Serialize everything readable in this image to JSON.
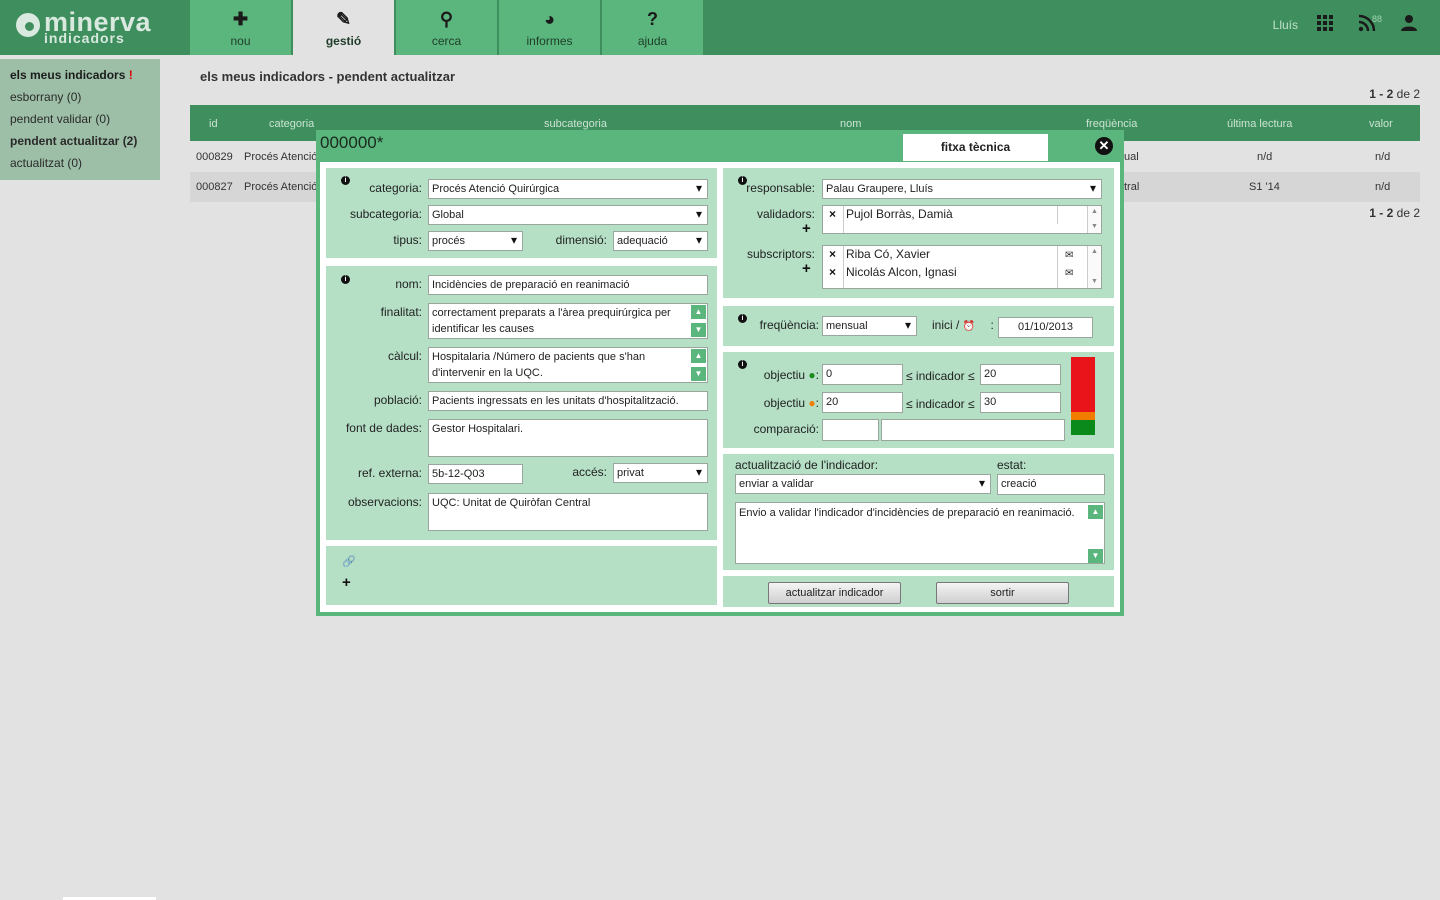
{
  "app": {
    "logo_main": "minerva",
    "logo_sub": "indicadors"
  },
  "nav": [
    {
      "label": "nou",
      "icon": "plus-grid-icon",
      "glyph": "✚"
    },
    {
      "label": "gestió",
      "icon": "edit-icon",
      "glyph": "✎"
    },
    {
      "label": "cerca",
      "icon": "search-icon",
      "glyph": "⚲"
    },
    {
      "label": "informes",
      "icon": "pie-chart-icon",
      "glyph": "◕"
    },
    {
      "label": "ajuda",
      "icon": "question-icon",
      "glyph": "?"
    }
  ],
  "header": {
    "user": "Lluís",
    "rss_count": "88"
  },
  "sidemenu": {
    "title": "els meus indicadors",
    "title_mark": "!",
    "items": [
      "esborrany (0)",
      "pendent validar (0)",
      "pendent actualitzar (2)",
      "actualitzat (0)"
    ]
  },
  "main": {
    "title": "els meus indicadors - pendent actualitzar",
    "pager_range": "1 - 2",
    "pager_of": "de 2",
    "columns": [
      "id",
      "categoria",
      "subcategoria",
      "nom",
      "freqüència",
      "última lectura",
      "valor"
    ],
    "rows": [
      {
        "id": "000829",
        "categoria": "Procés Atenció",
        "freq": "ual",
        "ultima": "n/d",
        "valor": "n/d"
      },
      {
        "id": "000827",
        "categoria": "Procés Atenció",
        "freq": "tral",
        "ultima": "S1 '14",
        "valor": "n/d"
      }
    ]
  },
  "modal": {
    "code": "000000*",
    "tab": "fitxa tècnica",
    "close": "✕",
    "general": {
      "categoria_label": "categoria:",
      "categoria": "Procés Atenció Quirúrgica",
      "subcategoria_label": "subcategoria:",
      "subcategoria": "Global",
      "tipus_label": "tipus:",
      "tipus": "procés",
      "dimensio_label": "dimensió:",
      "dimensio": "adequació"
    },
    "details": {
      "nom_label": "nom:",
      "nom": "Incidències de preparació en reanimació",
      "finalitat_label": "finalitat:",
      "finalitat": "correctament preparats a l'àrea prequirúrgica per identificar les causes",
      "calcul_label": "càlcul:",
      "calcul": "Hospitalaria /Número de pacients que s'han d'intervenir en la UQC.",
      "poblacio_label": "població:",
      "poblacio": "Pacients ingressats en les unitats d'hospitalització.",
      "font_label": "font de dades:",
      "font": "Gestor Hospitalari.",
      "ref_label": "ref. externa:",
      "ref": "5b-12-Q03",
      "acces_label": "accés:",
      "acces": "privat",
      "obs_label": "observacions:",
      "obs": "UQC: Unitat de Quiròfan Central"
    },
    "people": {
      "responsable_label": "responsable:",
      "responsable": "Palau Graupere, Lluís",
      "validadors_label": "validadors:",
      "validadors": [
        "Pujol Borràs, Damià"
      ],
      "subscriptors_label": "subscriptors:",
      "subscriptors": [
        "Riba Có, Xavier",
        "Nicolás Alcon, Ignasi"
      ]
    },
    "frequency": {
      "label": "freqüència:",
      "value": "mensual",
      "inici_label": "inici /",
      "inici_colon": ":",
      "inici": "01/10/2013"
    },
    "objectives": {
      "obj_label": "objectiu",
      "leq_ind": "≤ indicador ≤",
      "green_min": "0",
      "green_max": "20",
      "orange_min": "20",
      "orange_max": "30",
      "comparacio_label": "comparació:",
      "colors": {
        "red": "#e8141a",
        "orange": "#f07d00",
        "green": "#0a8a1a"
      },
      "gauge": {
        "red_fraction": 0.71,
        "orange_fraction": 0.1,
        "green_fraction": 0.19
      }
    },
    "update": {
      "label": "actualització de l'indicador:",
      "action": "enviar a validar",
      "estat_label": "estat:",
      "estat": "creació",
      "comment": "Envio a validar l'indicador d'incidències de preparació en reanimació."
    },
    "buttons": {
      "update": "actualitzar indicador",
      "exit": "sortir"
    }
  }
}
